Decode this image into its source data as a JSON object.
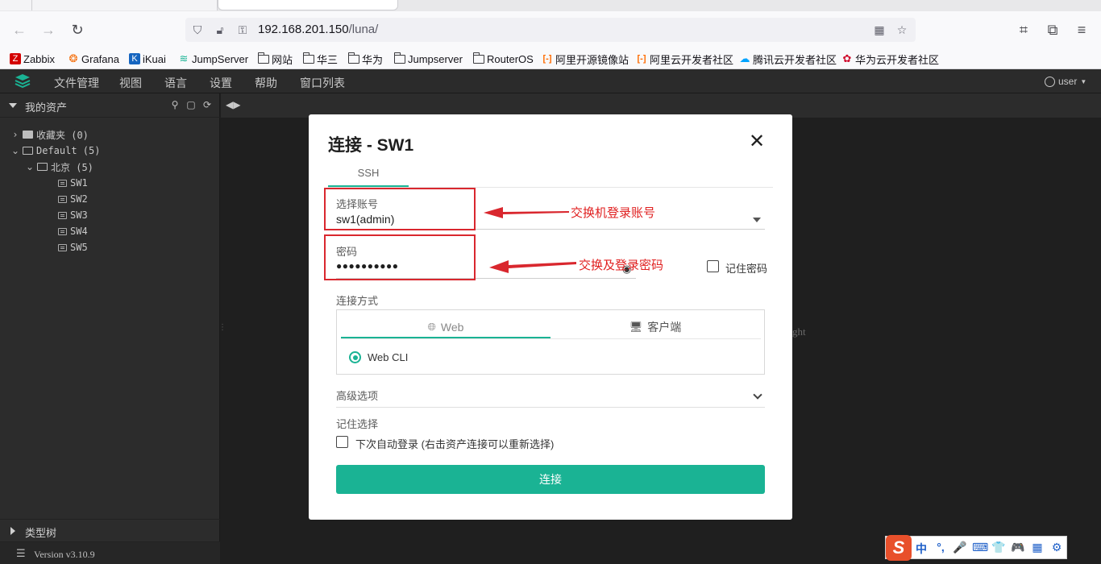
{
  "browser": {
    "url_host": "192.168.201.150",
    "url_path": "/luna/"
  },
  "bookmarks": [
    {
      "label": "Zabbix",
      "icon": "zabbix-icon",
      "color": "#d40000"
    },
    {
      "label": "Grafana",
      "icon": "grafana-icon",
      "color": "#f46800"
    },
    {
      "label": "iKuai",
      "icon": "ikuai-icon",
      "color": "#1565c0"
    },
    {
      "label": "JumpServer",
      "icon": "jumpserver-icon",
      "color": "#1ab394"
    },
    {
      "label": "网站",
      "icon": "folder-icon"
    },
    {
      "label": "华三",
      "icon": "folder-icon"
    },
    {
      "label": "华为",
      "icon": "folder-icon"
    },
    {
      "label": "Jumpserver",
      "icon": "folder-icon"
    },
    {
      "label": "RouterOS",
      "icon": "folder-icon"
    },
    {
      "label": "阿里开源镜像站",
      "icon": "aliyun-icon",
      "color": "#ff6a00"
    },
    {
      "label": "阿里云开发者社区",
      "icon": "aliyun-icon",
      "color": "#ff6a00"
    },
    {
      "label": "腾讯云开发者社区",
      "icon": "tencent-cloud-icon",
      "color": "#00a3ff"
    },
    {
      "label": "华为云开发者社区",
      "icon": "huawei-icon",
      "color": "#cf0a2c"
    }
  ],
  "app": {
    "menu": [
      "文件管理",
      "视图",
      "语言",
      "设置",
      "帮助",
      "窗口列表"
    ],
    "user": "user"
  },
  "sidebar": {
    "title": "我的资产",
    "tree": {
      "favorites": "收藏夹 (0)",
      "default": "Default (5)",
      "beijing": "北京 (5)",
      "assets": [
        "SW1",
        "SW2",
        "SW3",
        "SW4",
        "SW5"
      ]
    },
    "type_tree": "类型树",
    "version": "Version v3.10.9"
  },
  "main": {
    "copyright_tail": "ght"
  },
  "modal": {
    "title": "连接 - SW1",
    "protocol_tab": "SSH",
    "account_label": "选择账号",
    "account_value": "sw1(admin)",
    "password_label": "密码",
    "password_value": "●●●●●●●●●●",
    "remember_password": "记住密码",
    "connect_method_label": "连接方式",
    "method_tabs": [
      "Web",
      "客户端"
    ],
    "web_cli": "Web CLI",
    "advanced": "高级选项",
    "remember_choice_label": "记住选择",
    "auto_login": "下次自动登录 (右击资产连接可以重新选择)",
    "connect_button": "连接",
    "annotation_account": "交换机登录账号",
    "annotation_password": "交换及登录密码",
    "accent_color": "#1ab394",
    "annotation_color": "#d9272e"
  },
  "ime": {
    "logo": "S",
    "items": [
      "中",
      "°,",
      "🎤",
      "⌨",
      "👕",
      "🎮",
      "▦",
      "⚙"
    ]
  }
}
